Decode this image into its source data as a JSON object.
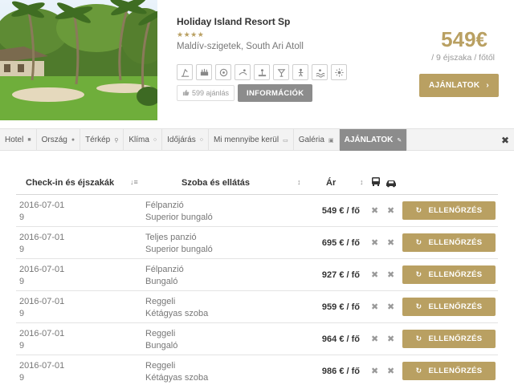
{
  "hotel": {
    "name": "Holiday Island Resort Sp",
    "stars": "★★★★",
    "location": "Maldív-szigetek, South Ari Atoll",
    "likes": "599 ajánlás",
    "info_label": "INFORMÁCIÓK",
    "price": "549€",
    "price_sub": "/ 9 éjszaka / főtől",
    "offers_label": "AJÁNLATOK",
    "amenities": [
      "beach-icon",
      "restaurant-icon",
      "spa-icon",
      "diving-icon",
      "gym-icon",
      "bar-icon",
      "kids-icon",
      "pool-icon",
      "sun-icon"
    ]
  },
  "tabs": [
    {
      "label": "Hotel",
      "icon": "■"
    },
    {
      "label": "Ország",
      "icon": "●"
    },
    {
      "label": "Térkép",
      "icon": "⚲"
    },
    {
      "label": "Klíma",
      "icon": "○"
    },
    {
      "label": "Időjárás",
      "icon": "○"
    },
    {
      "label": "Mi mennyibe kerül",
      "icon": "▭"
    },
    {
      "label": "Galéria",
      "icon": "▣"
    },
    {
      "label": "AJÁNLATOK",
      "icon": "✎"
    }
  ],
  "table": {
    "headers": {
      "checkin": "Check-in és éjszakák",
      "room": "Szoba és ellátás",
      "price": "Ár"
    },
    "check_label": "ELLENŐRZÉS",
    "rows": [
      {
        "date": "2016-07-01",
        "nights": "9",
        "board": "Félpanzió",
        "room": "Superior bungaló",
        "price": "549 € / fő"
      },
      {
        "date": "2016-07-01",
        "nights": "9",
        "board": "Teljes panzió",
        "room": "Superior bungaló",
        "price": "695 € / fő"
      },
      {
        "date": "2016-07-01",
        "nights": "9",
        "board": "Félpanzió",
        "room": "Bungaló",
        "price": "927 € / fő"
      },
      {
        "date": "2016-07-01",
        "nights": "9",
        "board": "Reggeli",
        "room": "Kétágyas szoba",
        "price": "959 € / fő"
      },
      {
        "date": "2016-07-01",
        "nights": "9",
        "board": "Reggeli",
        "room": "Bungaló",
        "price": "964 € / fő"
      },
      {
        "date": "2016-07-01",
        "nights": "9",
        "board": "Reggeli",
        "room": "Kétágyas szoba",
        "price": "986 € / fő"
      }
    ]
  },
  "colors": {
    "gold": "#b9a062",
    "grey_button": "#8c8c8c"
  }
}
